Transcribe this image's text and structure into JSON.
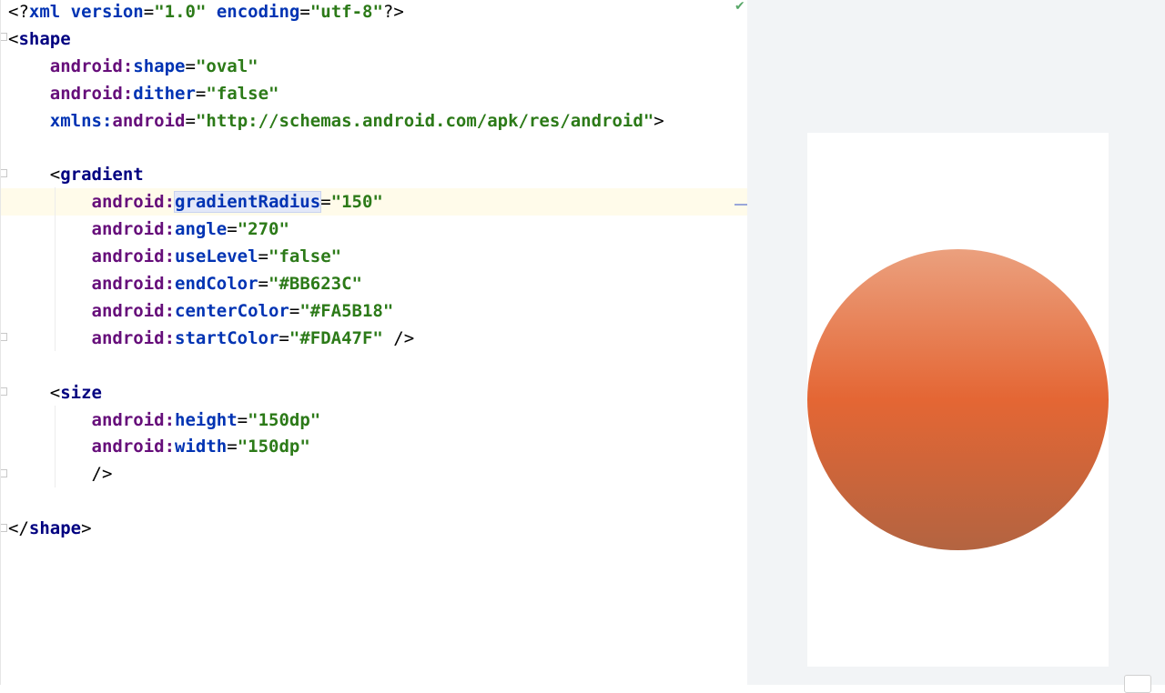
{
  "editor": {
    "lines": [
      {
        "tokens": [
          {
            "t": "<?",
            "c": "punc"
          },
          {
            "t": "xml",
            "c": "decl"
          },
          {
            "t": " ",
            "c": "punc"
          },
          {
            "t": "version",
            "c": "decl"
          },
          {
            "t": "=",
            "c": "eq"
          },
          {
            "t": "\"1.0\"",
            "c": "val"
          },
          {
            "t": " ",
            "c": "punc"
          },
          {
            "t": "encoding",
            "c": "decl"
          },
          {
            "t": "=",
            "c": "eq"
          },
          {
            "t": "\"utf-8\"",
            "c": "val"
          },
          {
            "t": "?>",
            "c": "punc"
          }
        ]
      },
      {
        "tokens": [
          {
            "t": "<",
            "c": "punc"
          },
          {
            "t": "shape",
            "c": "tag"
          }
        ]
      },
      {
        "tokens": [
          {
            "t": "    ",
            "c": "punc"
          },
          {
            "t": "android:",
            "c": "ns"
          },
          {
            "t": "shape",
            "c": "attr"
          },
          {
            "t": "=",
            "c": "eq"
          },
          {
            "t": "\"oval\"",
            "c": "val"
          }
        ]
      },
      {
        "tokens": [
          {
            "t": "    ",
            "c": "punc"
          },
          {
            "t": "android:",
            "c": "ns"
          },
          {
            "t": "dither",
            "c": "attr"
          },
          {
            "t": "=",
            "c": "eq"
          },
          {
            "t": "\"false\"",
            "c": "val"
          }
        ]
      },
      {
        "tokens": [
          {
            "t": "    ",
            "c": "punc"
          },
          {
            "t": "xmlns:",
            "c": "attr"
          },
          {
            "t": "android",
            "c": "ns"
          },
          {
            "t": "=",
            "c": "eq"
          },
          {
            "t": "\"http://schemas.android.com/apk/res/android\"",
            "c": "val"
          },
          {
            "t": ">",
            "c": "punc"
          }
        ]
      },
      {
        "tokens": []
      },
      {
        "tokens": [
          {
            "t": "    ",
            "c": "punc"
          },
          {
            "t": "<",
            "c": "punc"
          },
          {
            "t": "gradient",
            "c": "tag"
          }
        ]
      },
      {
        "tokens": [
          {
            "t": "        ",
            "c": "punc"
          },
          {
            "t": "android:",
            "c": "ns"
          },
          {
            "t": "gradientRadius",
            "c": "attr hl"
          },
          {
            "t": "=",
            "c": "eq"
          },
          {
            "t": "\"150\"",
            "c": "val"
          }
        ],
        "current": true
      },
      {
        "tokens": [
          {
            "t": "        ",
            "c": "punc"
          },
          {
            "t": "android:",
            "c": "ns"
          },
          {
            "t": "angle",
            "c": "attr"
          },
          {
            "t": "=",
            "c": "eq"
          },
          {
            "t": "\"270\"",
            "c": "val"
          }
        ]
      },
      {
        "tokens": [
          {
            "t": "        ",
            "c": "punc"
          },
          {
            "t": "android:",
            "c": "ns"
          },
          {
            "t": "useLevel",
            "c": "attr"
          },
          {
            "t": "=",
            "c": "eq"
          },
          {
            "t": "\"false\"",
            "c": "val"
          }
        ]
      },
      {
        "tokens": [
          {
            "t": "        ",
            "c": "punc"
          },
          {
            "t": "android:",
            "c": "ns"
          },
          {
            "t": "endColor",
            "c": "attr"
          },
          {
            "t": "=",
            "c": "eq"
          },
          {
            "t": "\"#BB623C\"",
            "c": "val"
          }
        ]
      },
      {
        "tokens": [
          {
            "t": "        ",
            "c": "punc"
          },
          {
            "t": "android:",
            "c": "ns"
          },
          {
            "t": "centerColor",
            "c": "attr"
          },
          {
            "t": "=",
            "c": "eq"
          },
          {
            "t": "\"#FA5B18\"",
            "c": "val"
          }
        ]
      },
      {
        "tokens": [
          {
            "t": "        ",
            "c": "punc"
          },
          {
            "t": "android:",
            "c": "ns"
          },
          {
            "t": "startColor",
            "c": "attr"
          },
          {
            "t": "=",
            "c": "eq"
          },
          {
            "t": "\"#FDA47F\"",
            "c": "val"
          },
          {
            "t": " />",
            "c": "punc"
          }
        ]
      },
      {
        "tokens": []
      },
      {
        "tokens": [
          {
            "t": "    ",
            "c": "punc"
          },
          {
            "t": "<",
            "c": "punc"
          },
          {
            "t": "size",
            "c": "tag"
          }
        ]
      },
      {
        "tokens": [
          {
            "t": "        ",
            "c": "punc"
          },
          {
            "t": "android:",
            "c": "ns"
          },
          {
            "t": "height",
            "c": "attr"
          },
          {
            "t": "=",
            "c": "eq"
          },
          {
            "t": "\"150dp\"",
            "c": "val"
          }
        ]
      },
      {
        "tokens": [
          {
            "t": "        ",
            "c": "punc"
          },
          {
            "t": "android:",
            "c": "ns"
          },
          {
            "t": "width",
            "c": "attr"
          },
          {
            "t": "=",
            "c": "eq"
          },
          {
            "t": "\"150dp\"",
            "c": "val"
          }
        ]
      },
      {
        "tokens": [
          {
            "t": "        ",
            "c": "punc"
          },
          {
            "t": "/>",
            "c": "punc"
          }
        ]
      },
      {
        "tokens": []
      },
      {
        "tokens": [
          {
            "t": "</",
            "c": "punc"
          },
          {
            "t": "shape",
            "c": "tag"
          },
          {
            "t": ">",
            "c": "punc"
          }
        ]
      }
    ]
  },
  "icons": {
    "check": "✔"
  },
  "preview": {
    "gradient": {
      "startColor": "#EBA07E",
      "centerColor": "#E46634",
      "endColor": "#B36441"
    }
  },
  "colors": {
    "current_line": "#fffbea",
    "preview_background": "#f2f4f6"
  }
}
